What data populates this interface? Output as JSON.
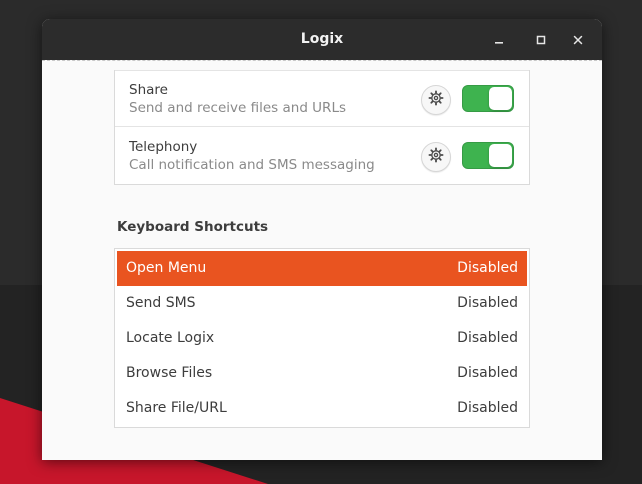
{
  "window": {
    "title": "Logix",
    "controls": [
      "minimize-icon",
      "maximize-icon",
      "close-icon"
    ]
  },
  "plugins": [
    {
      "name": "Share",
      "description": "Send and receive files and URLs",
      "settings_icon": "gear-icon",
      "enabled": true
    },
    {
      "name": "Telephony",
      "description": "Call notification and SMS messaging",
      "settings_icon": "gear-icon",
      "enabled": true
    }
  ],
  "keyboard_shortcuts": {
    "heading": "Keyboard Shortcuts",
    "selected_index": 0,
    "items": [
      {
        "action": "Open Menu",
        "shortcut": "Disabled"
      },
      {
        "action": "Send SMS",
        "shortcut": "Disabled"
      },
      {
        "action": "Locate Logix",
        "shortcut": "Disabled"
      },
      {
        "action": "Browse Files",
        "shortcut": "Disabled"
      },
      {
        "action": "Share File/URL",
        "shortcut": "Disabled"
      }
    ]
  },
  "colors": {
    "accent": "#e95420",
    "toggle_on": "#3eb34f",
    "titlebar": "#2c2c2c",
    "desktop_red": "#c7162b"
  }
}
